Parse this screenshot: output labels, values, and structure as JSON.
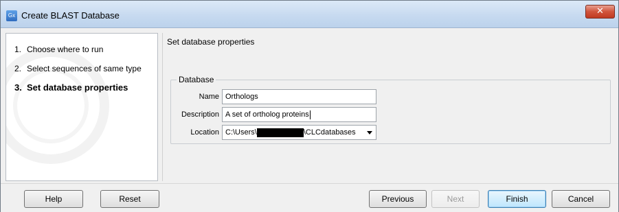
{
  "window": {
    "title": "Create BLAST Database",
    "app_icon": "Gx",
    "close_glyph": "✕"
  },
  "sidebar": {
    "steps": [
      {
        "num": "1.",
        "label": "Choose where to run"
      },
      {
        "num": "2.",
        "label": "Select sequences of same type"
      },
      {
        "num": "3.",
        "label": "Set database properties"
      }
    ]
  },
  "main": {
    "section_title": "Set database properties",
    "group_label": "Database",
    "fields": {
      "name_label": "Name",
      "name_value": "Orthologs",
      "description_label": "Description",
      "description_value": "A set of ortholog proteins",
      "location_label": "Location",
      "location_prefix": "C:\\Users\\",
      "location_suffix": "\\CLCdatabases"
    }
  },
  "buttons": {
    "help": "Help",
    "reset": "Reset",
    "previous": "Previous",
    "next": "Next",
    "finish": "Finish",
    "cancel": "Cancel"
  }
}
